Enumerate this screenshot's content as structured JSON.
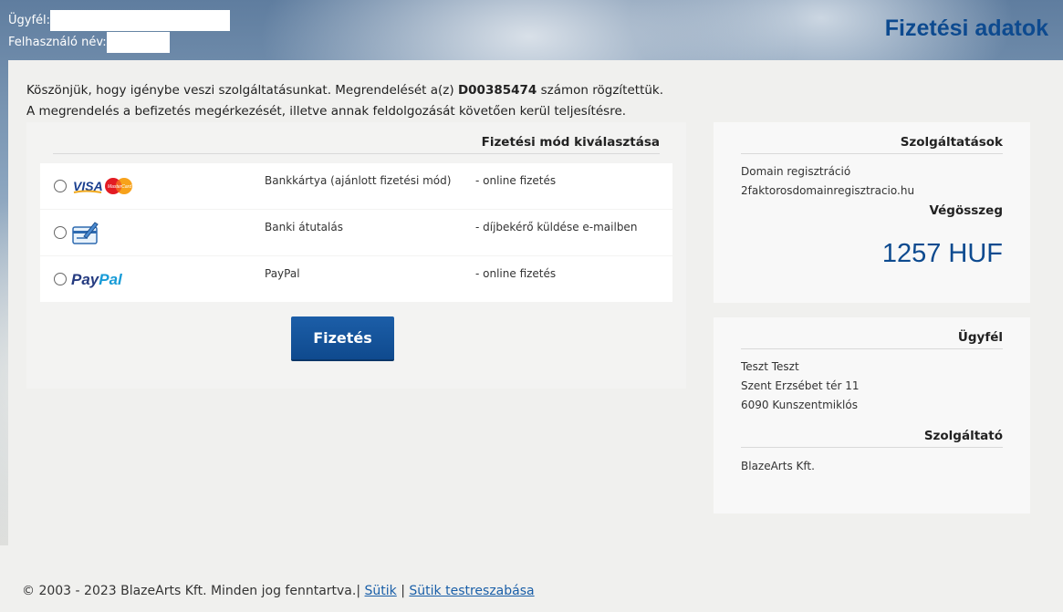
{
  "header": {
    "client_label": "Ügyfél:",
    "username_label": "Felhasználó név:",
    "page_title": "Fizetési adatok"
  },
  "intro": {
    "line1_prefix": "Köszönjük, hogy igénybe veszi szolgáltatásunkat. Megrendelését a(z) ",
    "order_id": "D00385474",
    "line1_suffix": " számon rögzítettük.",
    "line2": "A megrendelés a befizetés megérkezését, illetve annak feldolgozását követően kerül teljesítésre."
  },
  "payment": {
    "title": "Fizetési mód kiválasztása",
    "methods": [
      {
        "name": "Bankkártya (ajánlott fizetési mód)",
        "desc": "- online fizetés",
        "icon": "visa-mastercard-icon"
      },
      {
        "name": "Banki átutalás",
        "desc": "- díjbekérő küldése e-mailben",
        "icon": "bank-transfer-icon"
      },
      {
        "name": "PayPal",
        "desc": "- online fizetés",
        "icon": "paypal-icon"
      }
    ],
    "logo_text": {
      "visa": "VISA",
      "mastercard": "MasterCard",
      "paypal_pay": "Pay",
      "paypal_pal": "Pal"
    },
    "button_label": "Fizetés"
  },
  "services": {
    "title": "Szolgáltatások",
    "item": "Domain regisztráció",
    "domain": "2faktorosdomainregisztracio.hu",
    "total_label": "Végösszeg",
    "total_value": "1257 HUF"
  },
  "customer": {
    "title": "Ügyfél",
    "name": "Teszt Teszt",
    "address": "Szent Erzsébet tér 11",
    "city": "6090 Kunszentmiklós",
    "provider_title": "Szolgáltató",
    "provider": "BlazeArts Kft."
  },
  "footer": {
    "copyright": "© 2003 - 2023 BlazeArts Kft. Minden jog fenntartva.|",
    "cookies_link": "Sütik",
    "separator": "|",
    "cookie_settings_link": "Sütik testreszabása"
  },
  "colors": {
    "accent": "#0d4a8f",
    "button": "#1c5ea8",
    "panel": "#f0f0ee"
  }
}
